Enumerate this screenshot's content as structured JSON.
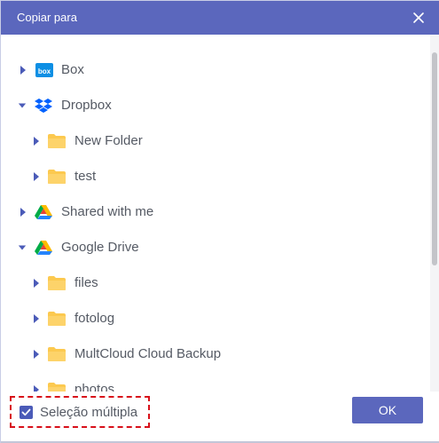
{
  "dialog": {
    "title": "Copiar para",
    "ok_label": "OK"
  },
  "multi_select": {
    "label": "Seleção múltipla",
    "checked": true
  },
  "tree": [
    {
      "label": "Box",
      "icon": "box-icon",
      "level": 0,
      "expanded": false
    },
    {
      "label": "Dropbox",
      "icon": "dropbox-icon",
      "level": 0,
      "expanded": true
    },
    {
      "label": "New Folder",
      "icon": "folder-icon",
      "level": 1,
      "expanded": false
    },
    {
      "label": "test",
      "icon": "folder-icon",
      "level": 1,
      "expanded": false
    },
    {
      "label": "Shared with me",
      "icon": "google-drive-icon",
      "level": 0,
      "expanded": false
    },
    {
      "label": "Google Drive",
      "icon": "google-drive-icon",
      "level": 0,
      "expanded": true
    },
    {
      "label": "files",
      "icon": "folder-icon",
      "level": 1,
      "expanded": false
    },
    {
      "label": "fotolog",
      "icon": "folder-icon",
      "level": 1,
      "expanded": false
    },
    {
      "label": "MultCloud Cloud Backup",
      "icon": "folder-icon",
      "level": 1,
      "expanded": false
    },
    {
      "label": "photos",
      "icon": "folder-icon",
      "level": 1,
      "expanded": false
    }
  ],
  "colors": {
    "header": "#5b67bd",
    "button": "#5b67bd",
    "checkbox": "#4b5bb8",
    "highlight": "#d8101a",
    "folder": "#fcc94f"
  }
}
